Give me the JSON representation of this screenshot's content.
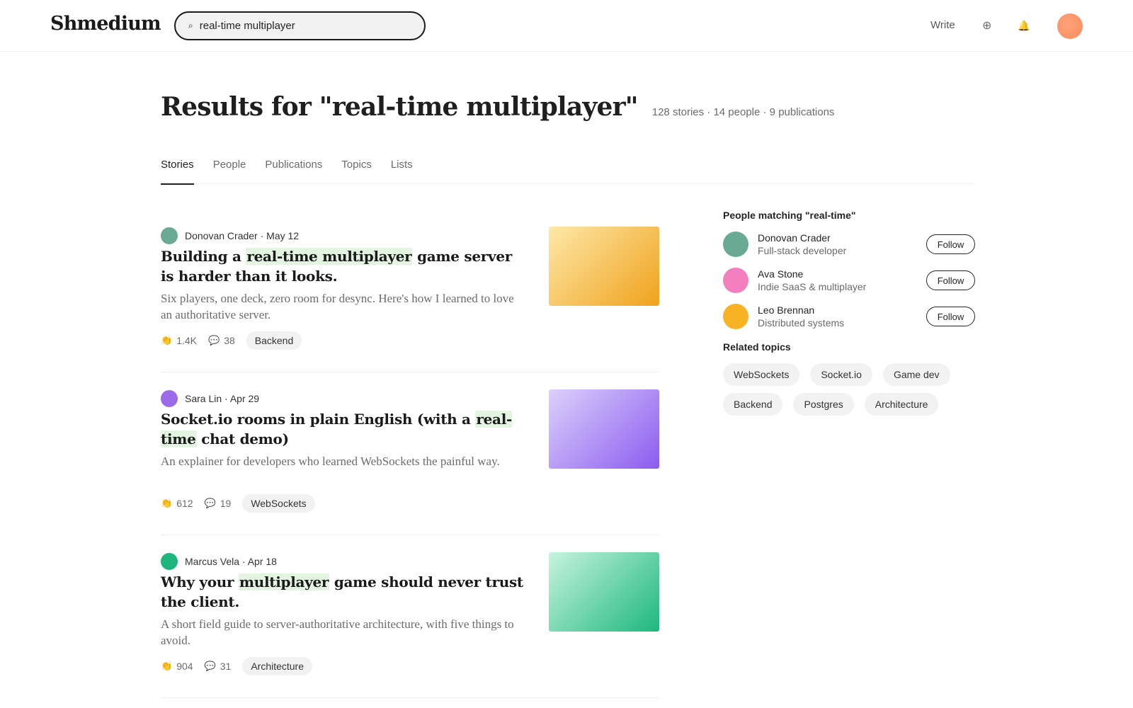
{
  "header": {
    "logo": "Shmedium",
    "search_value": "real-time multiplayer",
    "search_icon": "⌕",
    "write_label": "Write",
    "plus_icon": "⊕",
    "bell_icon": "🔔"
  },
  "results": {
    "title": "Results for \"real-time multiplayer\"",
    "counts": "128 stories · 14 people · 9 publications"
  },
  "tabs": [
    {
      "label": "Stories",
      "active": true
    },
    {
      "label": "People",
      "active": false
    },
    {
      "label": "Publications",
      "active": false
    },
    {
      "label": "Topics",
      "active": false
    },
    {
      "label": "Lists",
      "active": false
    }
  ],
  "stories": [
    {
      "author": "Donovan Crader · May 12",
      "avatar_color": "#6aaa94",
      "title_pre": "Building a ",
      "title_hl": "real-time multiplayer",
      "title_post": " game server is harder than it looks.",
      "subtitle": "Six players, one deck, zero room for desync. Here's how I learned to love an authoritative server.",
      "claps": "1.4K",
      "comments": "38",
      "tag": "Backend",
      "thumb_from": "#fde8a8",
      "thumb_to": "#f0a21c"
    },
    {
      "author": "Sara Lin · Apr 29",
      "avatar_color": "#9b6bea",
      "title_pre": "Socket.io rooms in plain English (with a ",
      "title_hl": "real-time",
      "title_post": " chat demo)",
      "subtitle": "An explainer for developers who learned WebSockets the painful way.",
      "claps": "612",
      "comments": "19",
      "tag": "WebSockets",
      "thumb_from": "#dcd0fb",
      "thumb_to": "#8b5cf0"
    },
    {
      "author": "Marcus Vela · Apr 18",
      "avatar_color": "#1fb57e",
      "title_pre": "Why your ",
      "title_hl": "multiplayer",
      "title_post": " game should never trust the client.",
      "subtitle": "A short field guide to server-authoritative architecture, with five things to avoid.",
      "claps": "904",
      "comments": "31",
      "tag": "Architecture",
      "thumb_from": "#c6f3df",
      "thumb_to": "#1db87c"
    }
  ],
  "sidebar": {
    "people_heading": "People matching \"real-time\"",
    "people": [
      {
        "name": "Donovan Crader",
        "desc": "Full-stack developer",
        "avatar_color": "#6aaa94",
        "follow_label": "Follow"
      },
      {
        "name": "Ava Stone",
        "desc": "Indie SaaS & multiplayer",
        "avatar_color": "#f47fbf",
        "follow_label": "Follow"
      },
      {
        "name": "Leo Brennan",
        "desc": "Distributed systems",
        "avatar_color": "#f7b323",
        "follow_label": "Follow"
      }
    ],
    "topics_heading": "Related topics",
    "topics": [
      "WebSockets",
      "Socket.io",
      "Game dev",
      "Backend",
      "Postgres",
      "Architecture"
    ]
  }
}
